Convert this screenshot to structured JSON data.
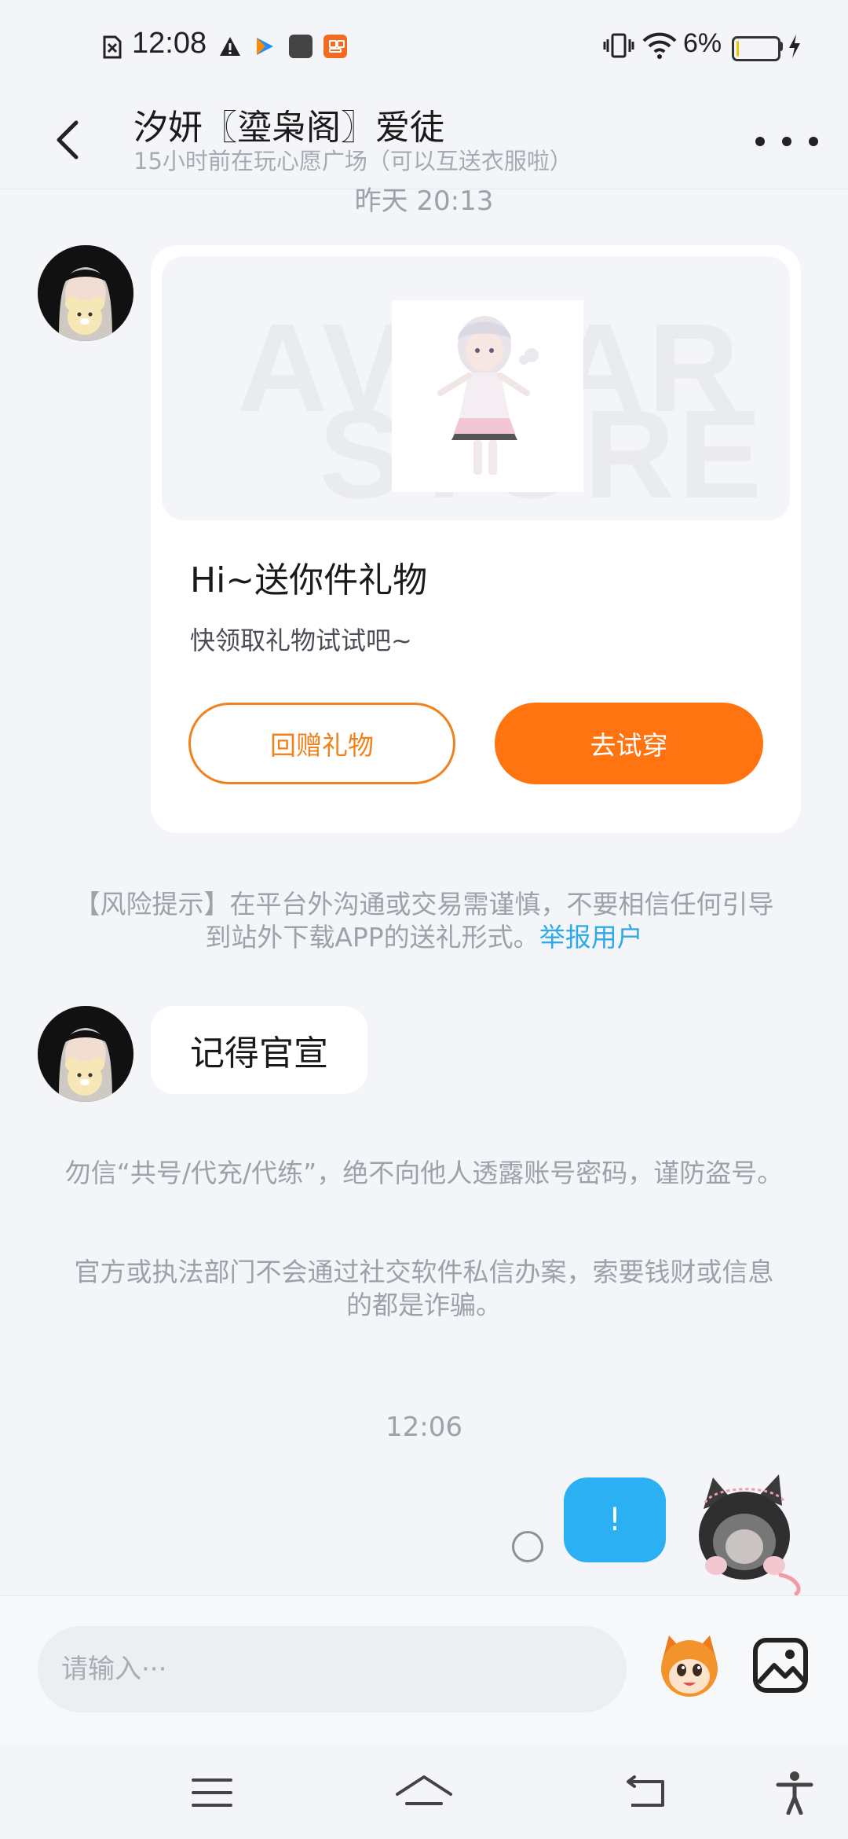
{
  "status_bar": {
    "time": "12:08",
    "battery_percent": "6%",
    "battery_level": 0.06,
    "icons": [
      "sim-off-icon",
      "alert-icon",
      "play-app-icon",
      "square-app-icon",
      "orange-app-icon",
      "vibrate-icon",
      "wifi-icon",
      "battery-icon",
      "charging-icon"
    ]
  },
  "header": {
    "title": "汐妍〖瑬枭阁〗爱徒",
    "subtitle": "15小时前在玩心愿广场（可以互送衣服啦）"
  },
  "messages": {
    "timestamp_1": "昨天  20:13",
    "gift_card": {
      "watermark_line1": "AVATAR",
      "watermark_line2": "STORE",
      "title": "Hi~送你件礼物",
      "description": "快领取礼物试试吧~",
      "return_gift_label": "回赠礼物",
      "try_on_label": "去试穿"
    },
    "risk_notice": {
      "text": "【风险提示】在平台外沟通或交易需谨慎，不要相信任何引导到站外下载APP的送礼形式。",
      "link": "举报用户"
    },
    "incoming_text": "记得官宣",
    "safety_notice_1": "勿信“共号/代充/代练”，绝不向他人透露账号密码，谨防盗号。",
    "safety_notice_2": "官方或执法部门不会通过社交软件私信办案，索要钱财或信息的都是诈骗。",
    "timestamp_2": "12:06",
    "outgoing_text": "!"
  },
  "input_bar": {
    "placeholder": "请输入···"
  },
  "colors": {
    "accent_orange": "#ff7411",
    "outgoing_bubble": "#2ab0f3",
    "link": "#2eaae6",
    "background": "#f3f5f9"
  }
}
